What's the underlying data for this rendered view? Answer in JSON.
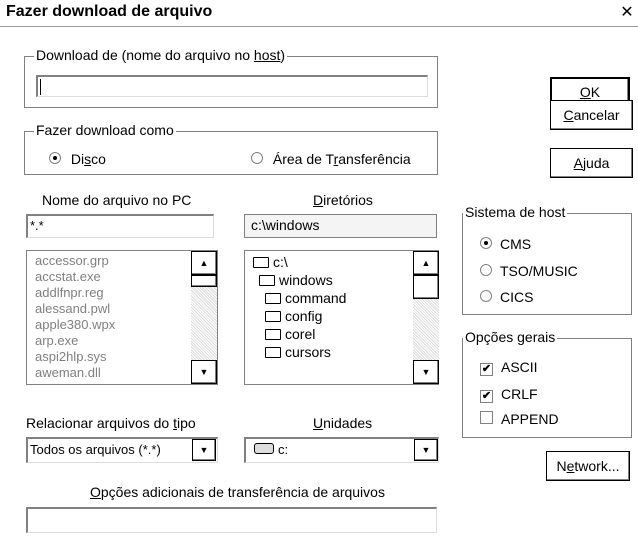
{
  "window": {
    "title": "Fazer download de arquivo",
    "close_glyph": "✕"
  },
  "download_from": {
    "legend_pre": "Download de (nome do arquivo no ",
    "legend_host": "host",
    "legend_post": ")",
    "value": ""
  },
  "download_as": {
    "legend": "Fazer download como",
    "disco_pre": "Di",
    "disco_u": "s",
    "disco_post": "co",
    "area_pre": "Área de T",
    "area_u": "r",
    "area_post": "ansferência",
    "selected": "disco"
  },
  "pc_file": {
    "label": "Nome do arquivo no PC",
    "value": "*.*",
    "files": [
      "accessor.grp",
      "accstat.exe",
      "addlfnpr.reg",
      "alessand.pwl",
      "apple380.wpx",
      "arp.exe",
      "aspi2hlp.sys",
      "aweman.dll"
    ]
  },
  "directories": {
    "label_u": "D",
    "label_rest": "iretórios",
    "path": "c:\\windows",
    "items": [
      {
        "name": "c:\\",
        "icon": "open-folder-icon",
        "indent": 0
      },
      {
        "name": "windows",
        "icon": "open-folder-icon",
        "indent": 1
      },
      {
        "name": "command",
        "icon": "folder-icon",
        "indent": 2
      },
      {
        "name": "config",
        "icon": "folder-icon",
        "indent": 2
      },
      {
        "name": "corel",
        "icon": "folder-icon",
        "indent": 2
      },
      {
        "name": "cursors",
        "icon": "folder-icon",
        "indent": 2
      }
    ]
  },
  "file_type": {
    "label_pre": "Relacionar arquivos do ",
    "label_u": "t",
    "label_post": "ipo",
    "value": "Todos os arquivos (*.*)"
  },
  "drives": {
    "label_u": "U",
    "label_rest": "nidades",
    "value": "c:"
  },
  "extra_options": {
    "label_u": "O",
    "label_rest": "pções adicionais de transferência de arquivos",
    "value": ""
  },
  "buttons": {
    "ok_u": "O",
    "ok_rest": "K",
    "cancel_u": "C",
    "cancel_rest": "ancelar",
    "help_u": "A",
    "help_rest": "juda",
    "network_pre": "N",
    "network_u": "e",
    "network_post": "twork..."
  },
  "host_system": {
    "legend": "Sistema de host",
    "options": [
      "CMS",
      "TSO/MUSIC",
      "CICS"
    ],
    "selected": "CMS"
  },
  "general_options": {
    "legend": "Opções gerais",
    "options": [
      "ASCII",
      "CRLF",
      "APPEND"
    ],
    "checked": [
      true,
      true,
      false
    ]
  },
  "icons": {
    "scroll_up": "▲",
    "scroll_down": "▼",
    "dropdown": "▼",
    "checkmark": "✔"
  }
}
